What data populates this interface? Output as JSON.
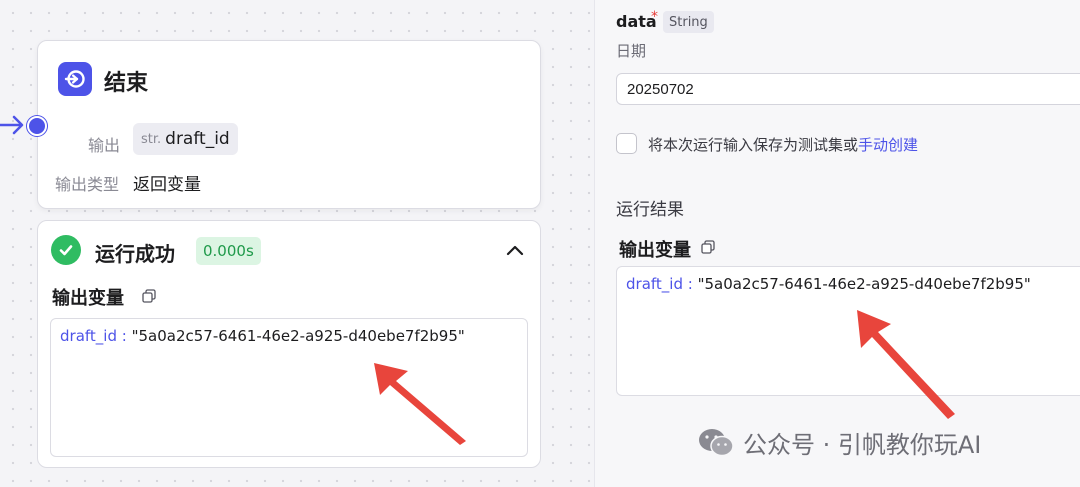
{
  "end_node": {
    "title": "结束",
    "output_label": "输出",
    "output_type_tag": "str.",
    "output_var": "draft_id",
    "output_type_label": "输出类型",
    "output_type_value": "返回变量"
  },
  "run_result_card": {
    "status": "运行成功",
    "duration": "0.000s",
    "output_title": "输出变量",
    "output_key": "draft_id :",
    "output_value": "\"5a0a2c57-6461-46e2-a925-d40ebe7f2b95\""
  },
  "test_panel": {
    "field_name": "data",
    "required_mark": "*",
    "field_type": "String",
    "field_desc": "日期",
    "input_value": "20250702",
    "save_checkbox_label": "将本次运行输入保存为测试集或",
    "save_checkbox_link": "手动创建",
    "run_result_title": "运行结果",
    "output_title": "输出变量",
    "output_key": "draft_id :",
    "output_value": "\"5a0a2c57-6461-46e2-a925-d40ebe7f2b95\""
  },
  "watermark": {
    "text": "公众号 · 引帆教你玩AI"
  },
  "colors": {
    "accent": "#4d53e8",
    "success": "#2fbc62",
    "arrow": "#e8453c"
  }
}
